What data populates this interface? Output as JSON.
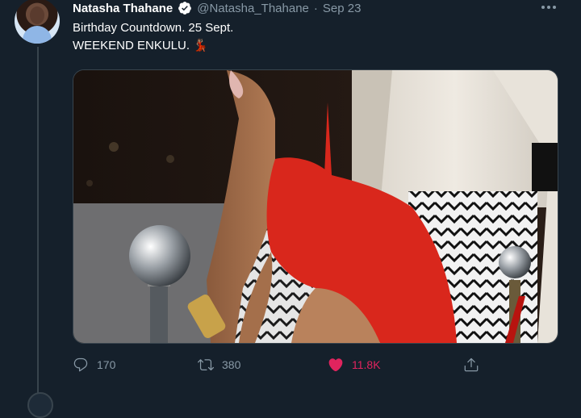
{
  "tweet": {
    "author_name": "Natasha Thahane",
    "handle": "@Natasha_Thahane",
    "separator": "·",
    "date": "Sep 23",
    "text_line1": "Birthday Countdown. 25 Sept.",
    "text_line2": "WEEKEND ENKULU. 💃🏽"
  },
  "actions": {
    "reply_count": "170",
    "retweet_count": "380",
    "like_count": "11.8K",
    "liked": true
  },
  "icons": {
    "verified": "verified-badge-icon",
    "more": "more-options-icon",
    "reply": "reply-icon",
    "retweet": "retweet-icon",
    "like": "heart-icon",
    "share": "share-icon"
  },
  "colors": {
    "background": "#15202b",
    "text_primary": "#ffffff",
    "text_secondary": "#8899a6",
    "like_active": "#e0245e",
    "verified_blue": "#1da1f2",
    "dress_red": "#d9271c"
  }
}
